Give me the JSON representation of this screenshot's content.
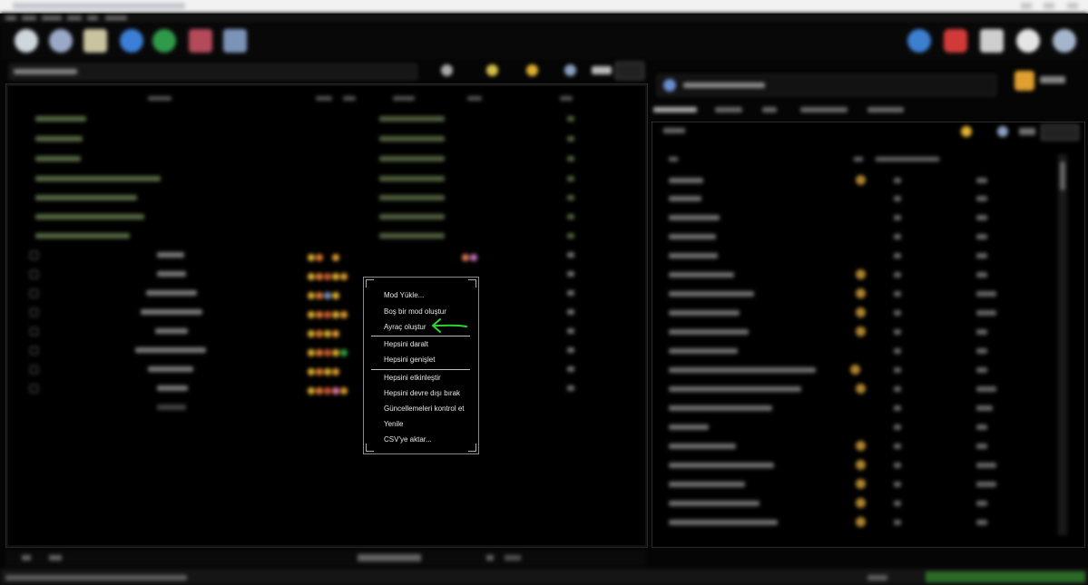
{
  "context_menu": {
    "items": [
      "Mod Yükle...",
      "Boş bir mod oluştur",
      "Ayraç oluştur",
      "Hepsini daralt",
      "Hepsini genişlet",
      "Hepsini etkinleştir",
      "Hepsini devre dışı bırak",
      "Güncellemeleri kontrol et",
      "Yenile",
      "CSV'ye aktar..."
    ]
  },
  "colors": {
    "annotation_arrow": "#2fd52f",
    "status_green": "#2f7a2a",
    "background": "#050505",
    "menu_border": "#8a8a8a"
  },
  "icons": [
    "settings-icon",
    "search-icon",
    "folder-icon",
    "web-icon",
    "download-icon",
    "tools-icon",
    "wrench-icon",
    "run-icon",
    "heart-icon",
    "home-icon",
    "help-icon"
  ]
}
